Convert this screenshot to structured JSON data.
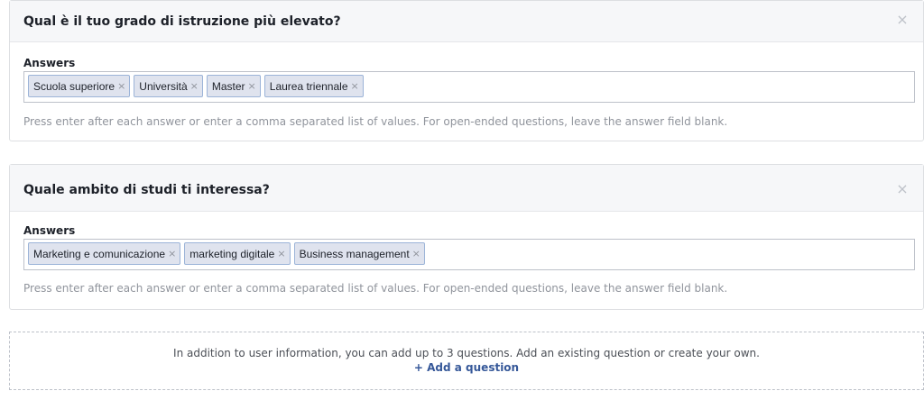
{
  "questions": [
    {
      "title": "Qual è il tuo grado di istruzione più elevato?",
      "close_icon": "×",
      "answers_label": "Answers",
      "answers": [
        "Scuola superiore",
        "Università",
        "Master",
        "Laurea triennale"
      ],
      "remove_icon": "×",
      "hint": "Press enter after each answer or enter a comma separated list of values. For open-ended questions, leave the answer field blank."
    },
    {
      "title": "Quale ambito di studi ti interessa?",
      "close_icon": "×",
      "answers_label": "Answers",
      "answers": [
        "Marketing e comunicazione",
        "marketing digitale",
        "Business management"
      ],
      "remove_icon": "×",
      "hint": "Press enter after each answer or enter a comma separated list of values. For open-ended questions, leave the answer field blank."
    }
  ],
  "add_section": {
    "info_text": "In addition to user information, you can add up to 3 questions. Add an existing question or create your own.",
    "add_link": "+ Add a question"
  },
  "colors": {
    "header_bg": "#f6f7f9",
    "token_bg": "#dfe3ee",
    "token_border": "#9cb4d8",
    "link": "#365899",
    "hint": "#90949c"
  }
}
